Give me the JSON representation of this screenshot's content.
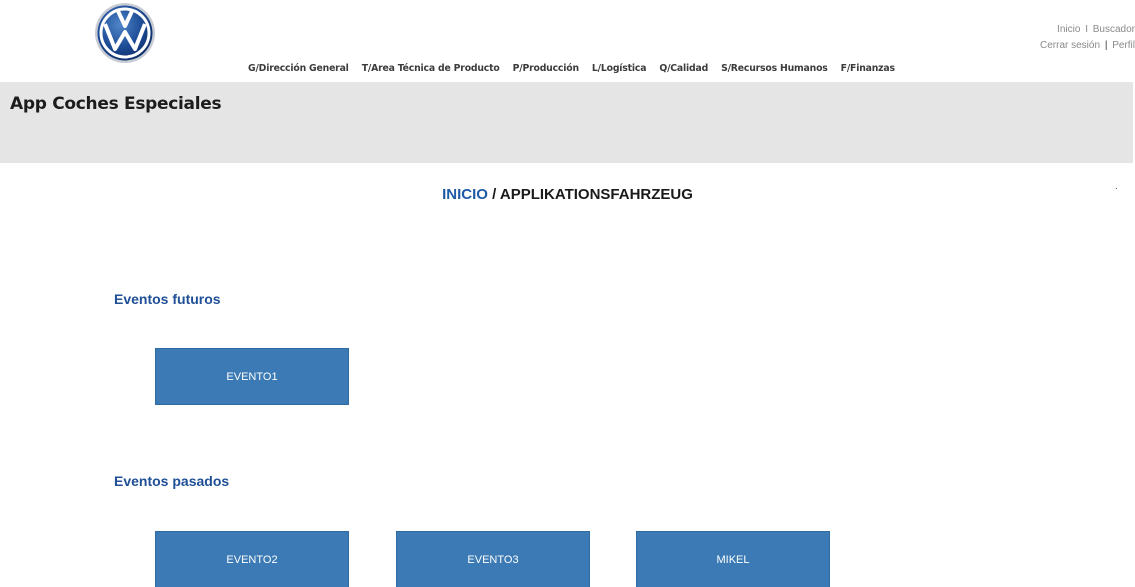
{
  "brand": {
    "logo_icon": "vw-logo-icon",
    "logo_text": "VW"
  },
  "top_links": {
    "inicio": "Inicio",
    "separator1": "I",
    "buscador": "Buscador",
    "cerrar_sesion": "Cerrar sesión",
    "separator2": "|",
    "perfil": "Perfil"
  },
  "main_nav": [
    {
      "label": "G/Dirección General"
    },
    {
      "label": "T/Area Técnica de Producto"
    },
    {
      "label": "P/Producción"
    },
    {
      "label": "L/Logística"
    },
    {
      "label": "Q/Calidad"
    },
    {
      "label": "S/Recursos Humanos"
    },
    {
      "label": "F/Finanzas"
    }
  ],
  "app_title": "App Coches Especiales",
  "breadcrumb": {
    "home": "INICIO",
    "separator": " / ",
    "current": "APPLIKATIONSFAHRZEUG"
  },
  "misc_dot": ".",
  "sections": {
    "future": {
      "title": "Eventos futuros",
      "events": [
        "EVENTO1"
      ]
    },
    "past": {
      "title": "Eventos pasados",
      "events": [
        "EVENTO2",
        "EVENTO3",
        "MIKEL"
      ]
    }
  },
  "colors": {
    "accent_blue": "#1f5aa6",
    "button_blue": "#3b7ab5",
    "band_grey": "#e5e5e5"
  }
}
